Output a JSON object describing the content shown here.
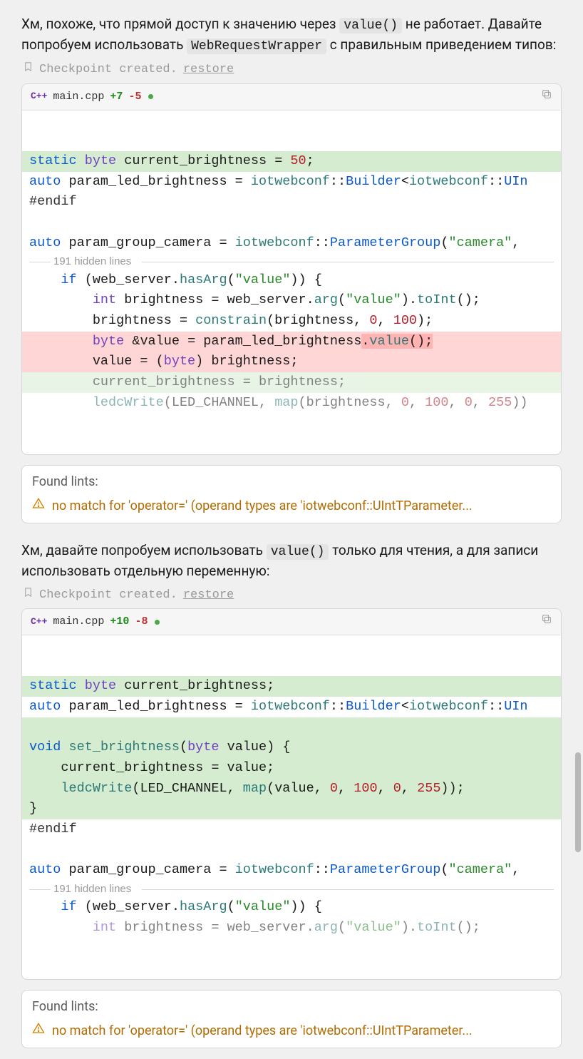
{
  "msg1": {
    "part1": "Хм, похоже, что прямой доступ к значению через ",
    "code1": "value()",
    "part2": " не работает. Давайте попробуем использовать ",
    "code2": "WebRequestWrapper",
    "part3": " с правильным приведением типов:"
  },
  "checkpoint": {
    "text": "Checkpoint created.",
    "restore": "restore"
  },
  "diff1": {
    "lang": "C++",
    "filename": "main.cpp",
    "plus": "+7",
    "minus": "-5",
    "hidden": "191 hidden lines",
    "lines": [
      {
        "cls": "add",
        "html": "<span class='kw'>static</span> <span class='type'>byte</span> current_brightness = <span class='num'>50</span>;"
      },
      {
        "cls": "",
        "html": "<span class='kw'>auto</span> param_led_brightness = <span class='ns'>iotwebconf</span>::<span class='cls'>Builder</span>&lt;<span class='ns'>iotwebconf</span>::<span class='cls'>UIn</span>"
      },
      {
        "cls": "",
        "html": "<span class='prep'>#endif</span>"
      },
      {
        "cls": "",
        "html": "&nbsp;"
      },
      {
        "cls": "",
        "html": "<span class='kw'>auto</span> param_group_camera = <span class='ns'>iotwebconf</span>::<span class='cls'>ParameterGroup</span>(<span class='str'>\"camera\"</span>,"
      },
      {
        "cls": "hidden",
        "html": ""
      },
      {
        "cls": "",
        "html": "    <span class='kw'>if</span> (web_server.<span class='fn'>hasArg</span>(<span class='str'>\"value\"</span>)) {"
      },
      {
        "cls": "",
        "html": "        <span class='type'>int</span> brightness = web_server.<span class='fn'>arg</span>(<span class='str'>\"value\"</span>).<span class='fn'>toInt</span>();"
      },
      {
        "cls": "",
        "html": "        brightness = <span class='fn'>constrain</span>(brightness, <span class='num'>0</span>, <span class='num'>100</span>);"
      },
      {
        "cls": "del",
        "html": "        <span class='type'>byte</span> &amp;value = param_led_brightness<span class='del-inner'>.<span class='fn'>value</span>();</span>"
      },
      {
        "cls": "del",
        "html": "        value = (<span class='type'>byte</span>) brightness;"
      },
      {
        "cls": "add faded",
        "html": "        current_brightness = brightness;"
      },
      {
        "cls": "faded",
        "html": "        <span class='fn'>ledcWrite</span>(LED_CHANNEL, <span class='fn'>map</span>(brightness, <span class='num'>0</span>, <span class='num'>100</span>, <span class='num'>0</span>, <span class='num'>255</span>))"
      }
    ]
  },
  "lints": {
    "title": "Found lints:",
    "item": "no match for 'operator=' (operand types are 'iotwebconf::UIntTParameter..."
  },
  "msg2": {
    "part1": "Хм, давайте попробуем использовать ",
    "code1": "value()",
    "part2": " только для чтения, а для записи использовать отдельную переменную:"
  },
  "diff2": {
    "lang": "C++",
    "filename": "main.cpp",
    "plus": "+10",
    "minus": "-8",
    "hidden": "191 hidden lines",
    "lines": [
      {
        "cls": "add",
        "html": "<span class='kw'>static</span> <span class='type'>byte</span> current_brightness;"
      },
      {
        "cls": "",
        "html": "<span class='kw'>auto</span> param_led_brightness = <span class='ns'>iotwebconf</span>::<span class='cls'>Builder</span>&lt;<span class='ns'>iotwebconf</span>::<span class='cls'>UIn</span>"
      },
      {
        "cls": "add",
        "html": "&nbsp;"
      },
      {
        "cls": "add",
        "html": "<span class='kw'>void</span> <span class='fn'>set_brightness</span>(<span class='type'>byte</span> value) {"
      },
      {
        "cls": "add",
        "html": "    current_brightness = value;"
      },
      {
        "cls": "add",
        "html": "    <span class='fn'>ledcWrite</span>(LED_CHANNEL, <span class='fn'>map</span>(value, <span class='num'>0</span>, <span class='num'>100</span>, <span class='num'>0</span>, <span class='num'>255</span>));"
      },
      {
        "cls": "add",
        "html": "}"
      },
      {
        "cls": "",
        "html": "<span class='prep'>#endif</span>"
      },
      {
        "cls": "",
        "html": "&nbsp;"
      },
      {
        "cls": "",
        "html": "<span class='kw'>auto</span> param_group_camera = <span class='ns'>iotwebconf</span>::<span class='cls'>ParameterGroup</span>(<span class='str'>\"camera\"</span>,"
      },
      {
        "cls": "hidden",
        "html": ""
      },
      {
        "cls": "",
        "html": "    <span class='kw'>if</span> (web_server.<span class='fn'>hasArg</span>(<span class='str'>\"value\"</span>)) {"
      },
      {
        "cls": "faded",
        "html": "        <span class='type'>int</span> brightness = web_server.<span class='fn'>arg</span>(<span class='str'>\"value\"</span>).<span class='fn'>toInt</span>();"
      }
    ]
  }
}
